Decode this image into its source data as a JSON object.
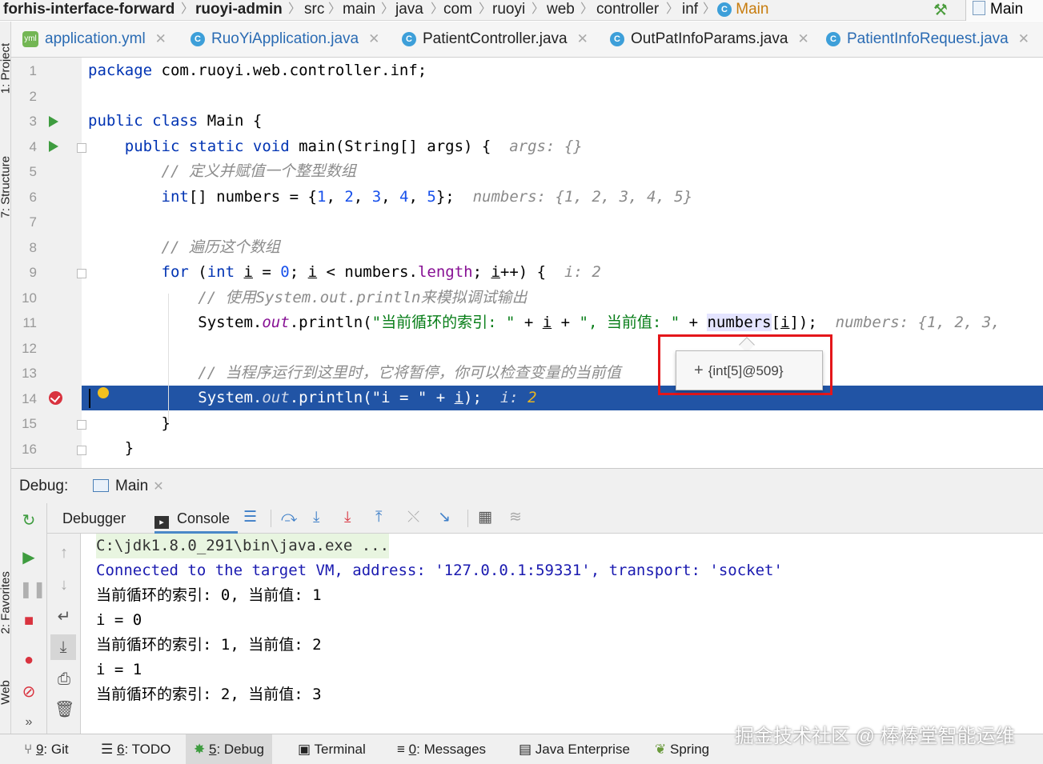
{
  "breadcrumb": {
    "items": [
      "forhis-interface-forward",
      "ruoyi-admin",
      "src",
      "main",
      "java",
      "com",
      "ruoyi",
      "web",
      "controller",
      "inf",
      "Main"
    ]
  },
  "run_config": {
    "label": "Main"
  },
  "left_strip": {
    "project": "1: Project",
    "structure": "7: Structure",
    "favorites": "2: Favorites",
    "web": "Web"
  },
  "tabs": [
    {
      "label": "application.yml",
      "icon": "yaml-file-icon"
    },
    {
      "label": "RuoYiApplication.java",
      "icon": "java-class-icon"
    },
    {
      "label": "PatientController.java",
      "icon": "java-class-icon"
    },
    {
      "label": "OutPatInfoParams.java",
      "icon": "java-class-icon"
    },
    {
      "label": "PatientInfoRequest.java",
      "icon": "java-class-icon"
    }
  ],
  "editor": {
    "line_numbers": [
      "1",
      "2",
      "3",
      "4",
      "5",
      "6",
      "7",
      "8",
      "9",
      "10",
      "11",
      "12",
      "13",
      "14",
      "15",
      "16"
    ],
    "code": {
      "l1_kw": "package",
      "l1_rest": " com.ruoyi.web.controller.inf;",
      "l3_kw": "public class",
      "l3_rest": " Main {",
      "l4_kw": "public static void",
      "l4_mid": " main(String[] args) {",
      "l4_hint": "args: {}",
      "l5_cmt": "// 定义并赋值一个整型数组",
      "l6_kw": "int",
      "l6_a": "[] numbers = {",
      "l6_n1": "1",
      "l6_n2": "2",
      "l6_n3": "3",
      "l6_n4": "4",
      "l6_n5": "5",
      "l6_end": "};",
      "l6_hint": "numbers: {1, 2, 3, 4, 5}",
      "l8_cmt": "// 遍历这个数组",
      "l9_for": "for",
      "l9_int": "int",
      "l9_zero": "0",
      "l9_field": "length",
      "l9_hint": "i: 2",
      "l10_cmt": "// 使用System.out.println来模拟调试输出",
      "l11_sys": "System.",
      "l11_out": "out",
      "l11_a": ".println(",
      "l11_s1": "\"当前循环的索引: \"",
      "l11_s2": "\", 当前值: \"",
      "l11_numbers": "numbers",
      "l11_hint": "numbers: {1, 2, 3,",
      "l13_cmt": "// 当程序运行到这里时，它将暂停，你可以检查变量的当前值",
      "l14_sys": "System.",
      "l14_out": "out",
      "l14_a": ".println(\"i = \" + ",
      "l14_hint_label": "i:",
      "l14_hint_val": "2",
      "l15": "}",
      "l16": "}"
    },
    "tooltip": "{int[5]@509}"
  },
  "debug": {
    "label": "Debug:",
    "session_tab": "Main",
    "tabs": {
      "debugger": "Debugger",
      "console": "Console"
    },
    "console_lines": [
      "C:\\jdk1.8.0_291\\bin\\java.exe ...",
      "Connected to the target VM, address: '127.0.0.1:59331', transport: 'socket'",
      "当前循环的索引: 0, 当前值: 1",
      "i = 0",
      "当前循环的索引: 1, 当前值: 2",
      "i = 1",
      "当前循环的索引: 2, 当前值: 3"
    ]
  },
  "bottom_bar": {
    "git_key": "9",
    "git": ": Git",
    "todo_key": "6",
    "todo": ": TODO",
    "debug_key": "5",
    "debug": ": Debug",
    "terminal": "Terminal",
    "messages_key": "0",
    "messages": ": Messages",
    "java_enterprise": "Java Enterprise",
    "spring": "Spring"
  },
  "watermark": "掘金技术社区 @ 棒棒堂智能运维"
}
